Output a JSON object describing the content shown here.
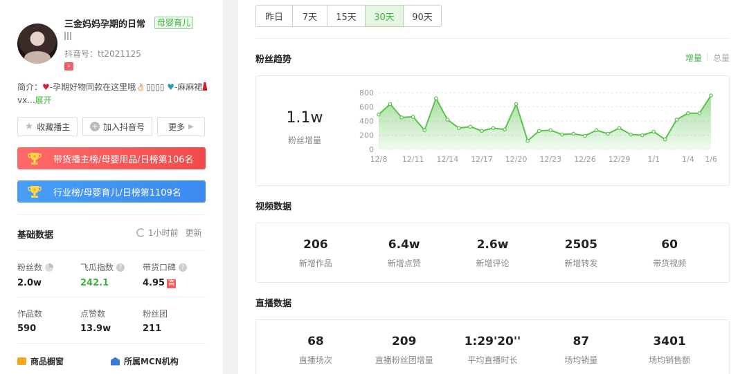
{
  "profile": {
    "name": "三金妈妈孕期的日常",
    "category_tag": "母婴育儿",
    "douyin_id": "抖音号：tt2021125",
    "intro_prefix": "简介：",
    "intro_part1": "-孕期好物同款在这里哦👌🏻▯▯▯▯ ",
    "intro_part2": "-麻麻裙",
    "intro_part3": "vx...",
    "expand": "展开"
  },
  "actions": {
    "favorite": "收藏播主",
    "add": "加入抖音号",
    "more": "更多"
  },
  "ranks": {
    "goods": "带货播主榜/母婴用品/日榜第106名",
    "industry": "行业榜/母婴育儿/日榜第1109名"
  },
  "basic": {
    "title": "基础数据",
    "update_time": "1小时前",
    "update_action": "更新",
    "stats": [
      {
        "label": "粉丝数",
        "value": "2.0w"
      },
      {
        "label": "飞瓜指数",
        "value": "242.1"
      },
      {
        "label": "带货口碑",
        "value": "4.95",
        "badge": "高"
      },
      {
        "label": "作品数",
        "value": "590"
      },
      {
        "label": "点赞数",
        "value": "13.9w"
      },
      {
        "label": "粉丝团",
        "value": "211"
      }
    ]
  },
  "links": {
    "shop": "商品橱窗",
    "mcn": "所属MCN机构"
  },
  "range_tabs": [
    "昨日",
    "7天",
    "15天",
    "30天",
    "90天"
  ],
  "active_tab": "30天",
  "fans_trend": {
    "title": "粉丝趋势",
    "toggle_on": "增量",
    "toggle_off": "总量",
    "big_value": "1.1w",
    "big_label": "粉丝增量"
  },
  "chart_data": {
    "type": "area",
    "x": [
      "12/8",
      "12/9",
      "12/10",
      "12/11",
      "12/12",
      "12/13",
      "12/14",
      "12/15",
      "12/16",
      "12/17",
      "12/18",
      "12/19",
      "12/20",
      "12/21",
      "12/22",
      "12/23",
      "12/24",
      "12/25",
      "12/26",
      "12/27",
      "12/28",
      "12/29",
      "12/30",
      "12/31",
      "1/1",
      "1/2",
      "1/3",
      "1/4",
      "1/5",
      "1/6"
    ],
    "values": [
      490,
      640,
      450,
      460,
      270,
      720,
      420,
      300,
      320,
      260,
      300,
      280,
      640,
      120,
      260,
      270,
      210,
      220,
      190,
      270,
      220,
      300,
      210,
      200,
      250,
      140,
      420,
      510,
      510,
      760
    ],
    "tick_labels": [
      "12/8",
      "12/11",
      "12/14",
      "12/17",
      "12/20",
      "12/23",
      "12/26",
      "12/29",
      "1/1",
      "1/4",
      "1/6"
    ],
    "ylim": [
      0,
      800
    ],
    "yticks": [
      "800",
      "600",
      "400",
      "200",
      "0"
    ],
    "color": "#58c24a",
    "grid": true
  },
  "video": {
    "title": "视频数据",
    "metrics": [
      {
        "value": "206",
        "label": "新增作品"
      },
      {
        "value": "6.4w",
        "label": "新增点赞"
      },
      {
        "value": "2.6w",
        "label": "新增评论"
      },
      {
        "value": "2505",
        "label": "新增转发"
      },
      {
        "value": "60",
        "label": "带货视频"
      }
    ]
  },
  "live": {
    "title": "直播数据",
    "metrics": [
      {
        "value": "68",
        "label": "直播场次"
      },
      {
        "value": "209",
        "label": "直播粉丝团增量"
      },
      {
        "value": "1:29'20''",
        "label": "平均直播时长"
      },
      {
        "value": "87",
        "label": "场均销量"
      },
      {
        "value": "3401",
        "label": "场均销售额"
      }
    ]
  }
}
